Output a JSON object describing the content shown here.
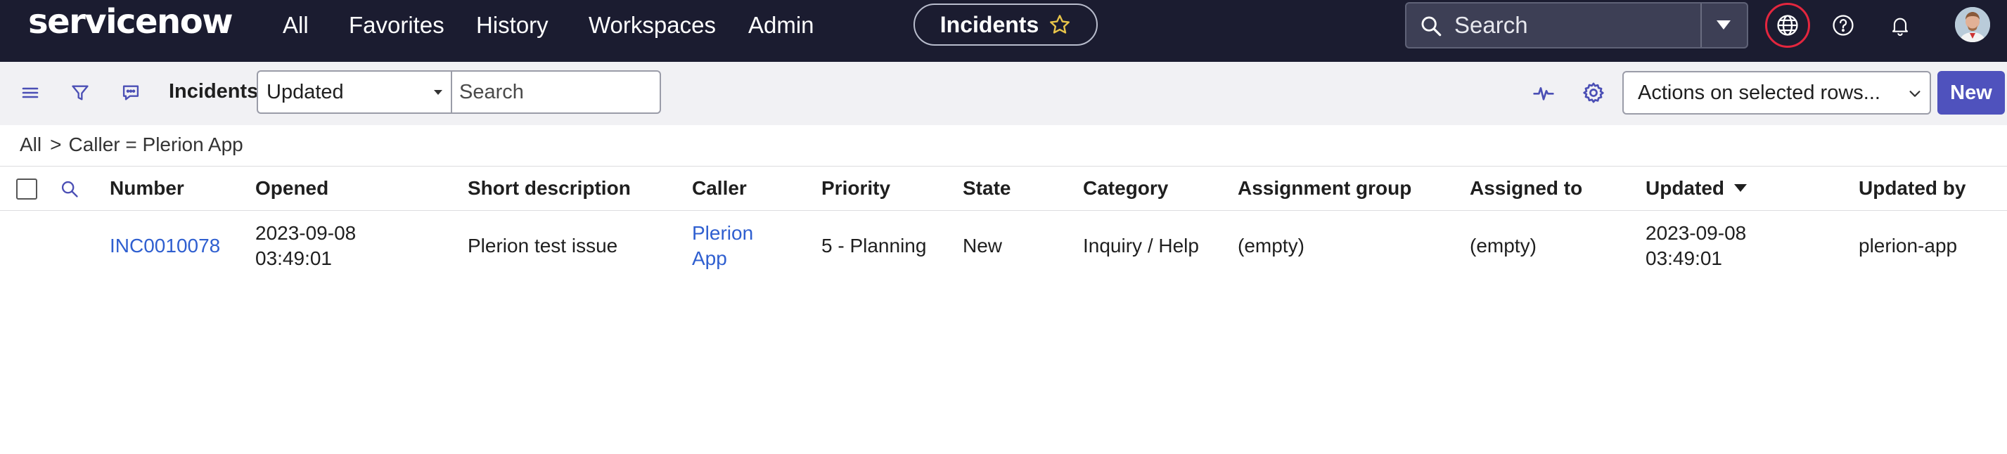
{
  "topnav": {
    "logo": "servicenow",
    "items": [
      "All",
      "Favorites",
      "History",
      "Workspaces",
      "Admin"
    ],
    "context_pill": "Incidents",
    "search_placeholder": "Search",
    "icons": [
      "globe-icon",
      "help-icon",
      "bell-icon",
      "user-avatar"
    ],
    "colors": {
      "bg": "#1b1c30",
      "star": "#e8c54a",
      "highlight_ring": "#e3263e"
    }
  },
  "toolbar": {
    "icons": [
      "hamburger-icon",
      "filter-icon",
      "chat-icon",
      "activity-icon",
      "gear-icon"
    ],
    "title": "Incidents",
    "search_field": "Updated",
    "search_placeholder": "Search",
    "actions_select": "Actions on selected rows...",
    "new_button": "New",
    "colors": {
      "new_button_bg": "#4f52bd"
    }
  },
  "breadcrumb": {
    "root": "All",
    "separator": ">",
    "condition": "Caller = Plerion App"
  },
  "table": {
    "columns": [
      "Number",
      "Opened",
      "Short description",
      "Caller",
      "Priority",
      "State",
      "Category",
      "Assignment group",
      "Assigned to",
      "Updated",
      "Updated by"
    ],
    "sorted_column": "Updated",
    "sort_direction": "descending",
    "rows": [
      {
        "number": "INC0010078",
        "opened_date": "2023-09-08",
        "opened_time": "03:49:01",
        "short_description": "Plerion test issue",
        "caller_line1": "Plerion",
        "caller_line2": "App",
        "priority": "5 - Planning",
        "state": "New",
        "category": "Inquiry / Help",
        "assignment_group": "(empty)",
        "assigned_to": "(empty)",
        "updated_date": "2023-09-08",
        "updated_time": "03:49:01",
        "updated_by": "plerion-app"
      }
    ]
  }
}
